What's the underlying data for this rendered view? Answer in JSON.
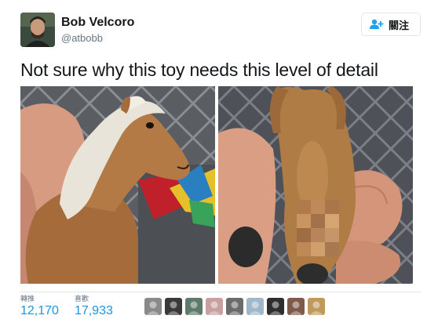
{
  "user": {
    "display_name": "Bob Velcoro",
    "handle": "@atbobb"
  },
  "follow_button": {
    "label": "關注",
    "icon": "add-user-icon",
    "color": "#1da1f2"
  },
  "tweet": {
    "text": "Not sure why this toy needs this level of detail"
  },
  "media": [
    {
      "name": "toy-horse-head-photo",
      "icon": "photo"
    },
    {
      "name": "toy-horse-underside-photo",
      "icon": "photo"
    }
  ],
  "stats": [
    {
      "label": "轉推",
      "value": "12,170"
    },
    {
      "label": "喜歡",
      "value": "17,933"
    }
  ],
  "likers": [
    {
      "color": "#8a8a8a"
    },
    {
      "color": "#3a3a3a"
    },
    {
      "color": "#5d7a6a"
    },
    {
      "color": "#c8a0a0"
    },
    {
      "color": "#6b6b6b"
    },
    {
      "color": "#9fb7c9"
    },
    {
      "color": "#2e2e2e"
    },
    {
      "color": "#7d5a4a"
    },
    {
      "color": "#c09a5a"
    }
  ],
  "colors": {
    "link_blue": "#1b95e0",
    "muted": "#657786",
    "border": "#e1e8ed"
  }
}
